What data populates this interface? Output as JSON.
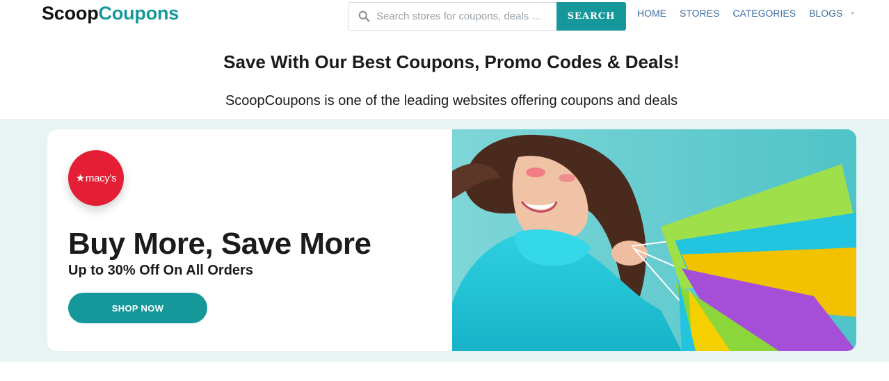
{
  "header": {
    "logo_part1": "Scoop",
    "logo_part2": "Coupons",
    "search_placeholder": "Search stores for coupons, deals ...",
    "search_button": "SEARCH",
    "nav": [
      "HOME",
      "STORES",
      "CATEGORIES",
      "BLOGS"
    ]
  },
  "intro": {
    "title": "Save With Our Best Coupons, Promo Codes & Deals!",
    "subtitle": "ScoopCoupons is one of the leading websites offering coupons and deals"
  },
  "hero": {
    "brand": "macy's",
    "title": "Buy More, Save More",
    "subtitle": "Up to 30% Off On All Orders",
    "cta": "SHOP NOW"
  },
  "colors": {
    "accent": "#16989a",
    "nav": "#3f6f9f",
    "band": "#e8f3f3",
    "brand_red": "#e41f35"
  },
  "icons": [
    "search-icon",
    "chevron-down-icon",
    "macys-star-icon"
  ]
}
